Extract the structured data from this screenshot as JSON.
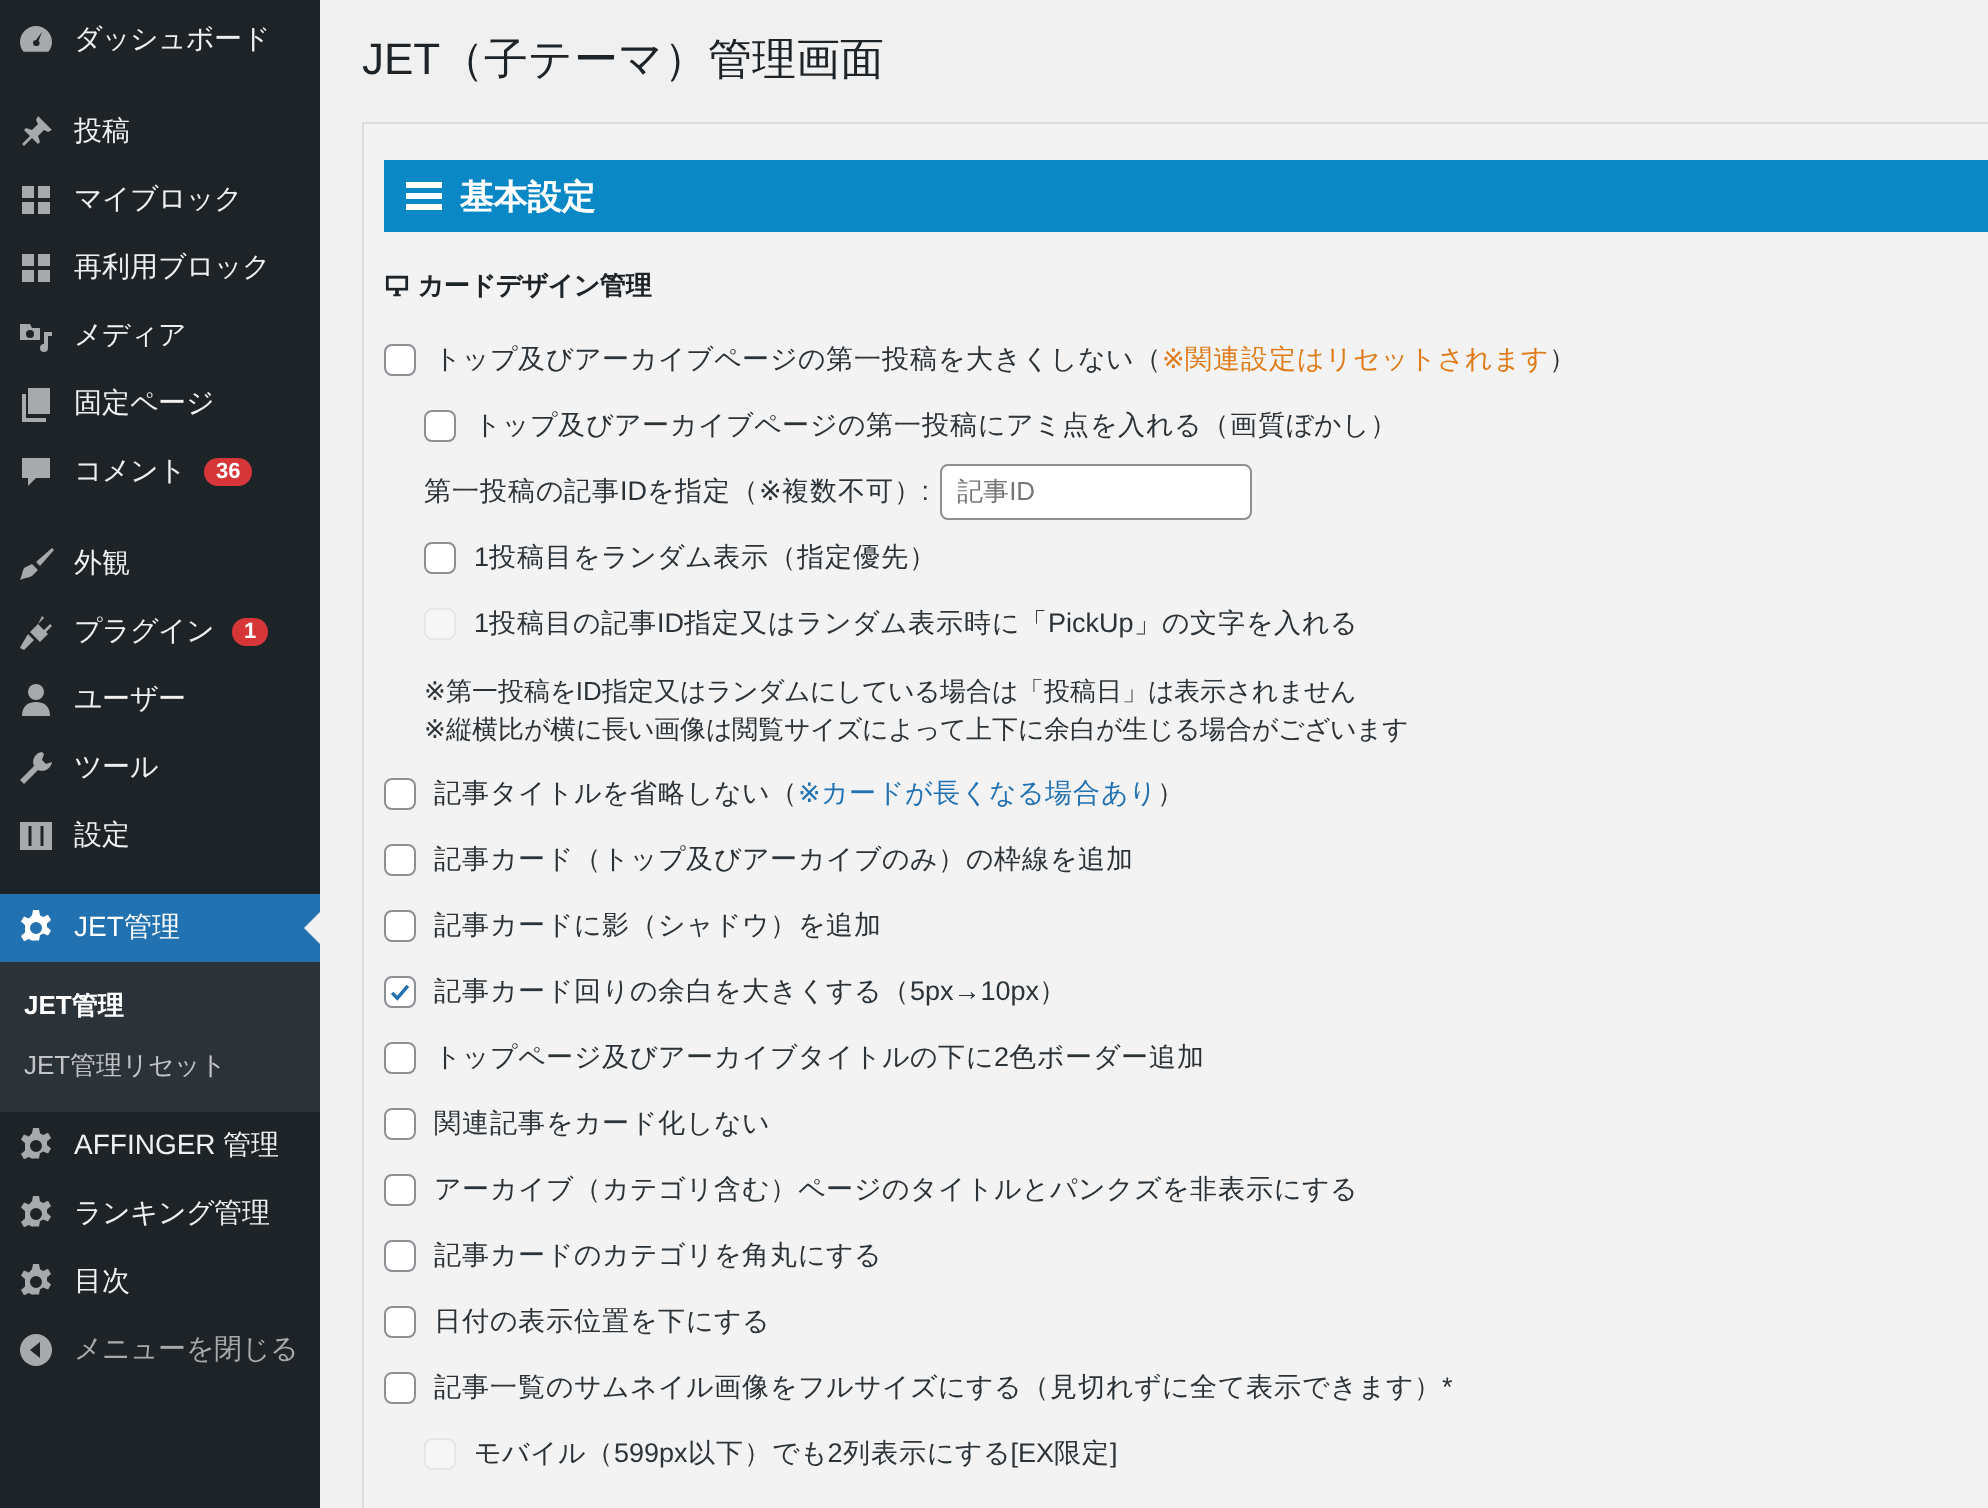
{
  "sidebar": {
    "groups": [
      [
        {
          "label": "ダッシュボード"
        }
      ],
      [
        {
          "label": "投稿"
        },
        {
          "label": "マイブロック"
        },
        {
          "label": "再利用ブロック"
        },
        {
          "label": "メディア"
        },
        {
          "label": "固定ページ"
        },
        {
          "label": "コメント",
          "badge": "36"
        }
      ],
      [
        {
          "label": "外観"
        },
        {
          "label": "プラグイン",
          "badge": "1"
        },
        {
          "label": "ユーザー"
        },
        {
          "label": "ツール"
        },
        {
          "label": "設定"
        }
      ],
      [
        {
          "label": "JET管理",
          "selected": true,
          "submenu": [
            {
              "label": "JET管理",
              "selected": true
            },
            {
              "label": "JET管理リセット",
              "selected": false
            }
          ]
        },
        {
          "label": "AFFINGER 管理",
          "selected": false
        },
        {
          "label": "ランキング管理",
          "selected": false
        },
        {
          "label": "目次",
          "selected": false
        },
        {
          "label": "メニューを閉じる",
          "kind": "collapse",
          "selected": false
        }
      ]
    ]
  },
  "page_title": "JET（子テーマ）管理画面",
  "section": {
    "title": "基本設定",
    "subtitle": "カードデザイン管理",
    "options": [
      {
        "kind": "checkbox",
        "label": "トップ及びアーカイブページの第一投稿を大きくしない（",
        "note": "※関連設定はリセットされます",
        "color": "#e07b1a",
        "after": "）",
        "checked": false,
        "disabled": false,
        "children": [
          {
            "kind": "checkbox",
            "label": "トップ及びアーカイブページの第一投稿にアミ点を入れる（画質ぼかし）",
            "checked": false,
            "disabled": false
          },
          {
            "kind": "input",
            "label": "第一投稿の記事IDを指定（※複数不可）:",
            "placeholder": "記事ID"
          },
          {
            "kind": "checkbox",
            "label": "1投稿目をランダム表示（指定優先）",
            "checked": false,
            "disabled": false
          },
          {
            "kind": "checkbox",
            "label": "1投稿目の記事ID指定又はランダム表示時に「PickUp」の文字を入れる",
            "checked": false,
            "disabled": true
          },
          {
            "kind": "note",
            "lines": [
              "※第一投稿をID指定又はランダムにしている場合は「投稿日」は表示されません",
              "※縦横比が横に長い画像は閲覧サイズによって上下に余白が生じる場合がございます"
            ]
          }
        ]
      },
      {
        "kind": "checkbox",
        "label": "記事タイトルを省略しない（",
        "note": "※カードが長くなる場合あり",
        "color": "#2271b1",
        "after": "）",
        "checked": false,
        "disabled": false
      },
      {
        "kind": "checkbox",
        "label": "記事カード（トップ及びアーカイブのみ）の枠線を追加",
        "checked": false,
        "disabled": false
      },
      {
        "kind": "checkbox",
        "label": "記事カードに影（シャドウ）を追加",
        "checked": false,
        "disabled": false
      },
      {
        "kind": "checkbox",
        "label": "記事カード回りの余白を大きくする（5px→10px）",
        "checked": true,
        "disabled": false
      },
      {
        "kind": "checkbox",
        "label": "トップページ及びアーカイブタイトルの下に2色ボーダー追加",
        "checked": false,
        "disabled": false
      },
      {
        "kind": "checkbox",
        "label": "関連記事をカード化しない",
        "checked": false,
        "disabled": false
      },
      {
        "kind": "checkbox",
        "label": "アーカイブ（カテゴリ含む）ページのタイトルとパンクズを非表示にする",
        "checked": false,
        "disabled": false
      },
      {
        "kind": "checkbox",
        "label": "記事カードのカテゴリを角丸にする",
        "checked": false,
        "disabled": false
      },
      {
        "kind": "checkbox",
        "label": "日付の表示位置を下にする",
        "checked": false,
        "disabled": false
      },
      {
        "kind": "checkbox",
        "label": "記事一覧のサムネイル画像をフルサイズにする（見切れずに全て表示できます）*",
        "checked": false,
        "disabled": false,
        "children": [
          {
            "kind": "checkbox",
            "label": "モバイル（599px以下）でも2列表示にする[EX限定]",
            "checked": false,
            "disabled": true
          }
        ]
      }
    ]
  }
}
